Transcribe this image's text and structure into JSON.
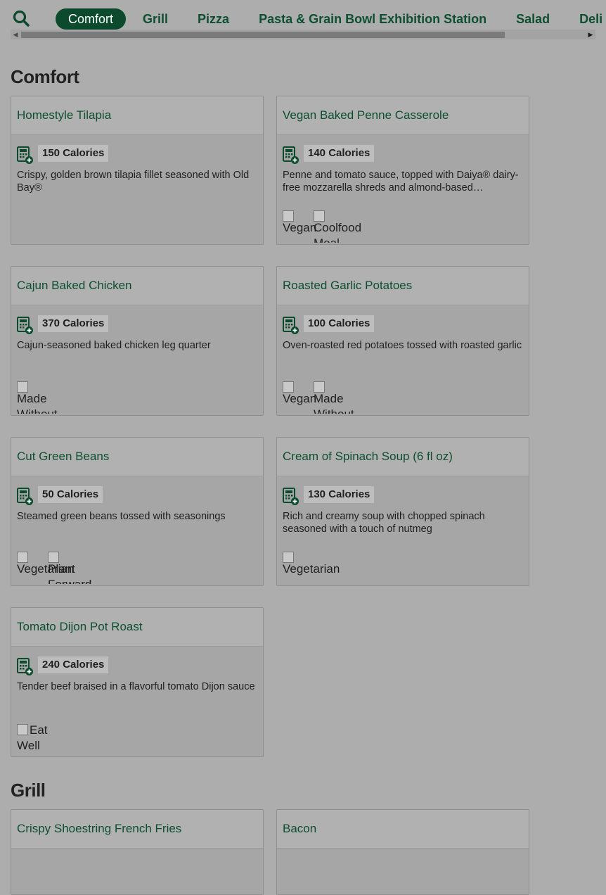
{
  "nav": {
    "tabs": [
      "Comfort",
      "Grill",
      "Pizza",
      "Pasta & Grain Bowl Exhibition Station",
      "Salad",
      "Deli"
    ],
    "active_tab": "Comfort"
  },
  "sections": [
    {
      "title": "Comfort",
      "items": [
        {
          "name": "Homestyle Tilapia",
          "calories": "150 Calories",
          "description": "Crispy, golden brown tilapia fillet seasoned with Old Bay®",
          "tags": []
        },
        {
          "name": "Vegan Baked Penne Casserole",
          "calories": "140 Calories",
          "description": "Penne and tomato sauce, topped with Daiya® dairy-free mozzarella shreds and almond-based…",
          "tags": [
            "Vegan",
            "Coolfood Meal"
          ]
        },
        {
          "name": "Cajun Baked Chicken",
          "calories": "370 Calories",
          "description": "Cajun-seasoned baked chicken leg quarter",
          "tags": [
            "Made Without"
          ]
        },
        {
          "name": "Roasted Garlic Potatoes",
          "calories": "100 Calories",
          "description": "Oven-roasted red potatoes tossed with roasted garlic",
          "tags": [
            "Vegan",
            "Made Without"
          ]
        },
        {
          "name": "Cut Green Beans",
          "calories": "50 Calories",
          "description": "Steamed green beans tossed with seasonings",
          "tags": [
            "Vegetarian",
            "Plant Forward"
          ]
        },
        {
          "name": "Cream of Spinach Soup (6 fl oz)",
          "calories": "130 Calories",
          "description": "Rich and creamy soup with chopped spinach seasoned with a touch of nutmeg",
          "tags": [
            "Vegetarian"
          ]
        },
        {
          "name": "Tomato Dijon Pot Roast",
          "calories": "240 Calories",
          "description": "Tender beef braised in a flavorful tomato Dijon sauce",
          "tags": [
            "Eat Well"
          ]
        }
      ]
    },
    {
      "title": "Grill",
      "items": [
        {
          "name": "Crispy Shoestring French Fries",
          "calories": "",
          "description": "",
          "tags": []
        },
        {
          "name": "Bacon",
          "calories": "",
          "description": "",
          "tags": []
        }
      ]
    }
  ]
}
